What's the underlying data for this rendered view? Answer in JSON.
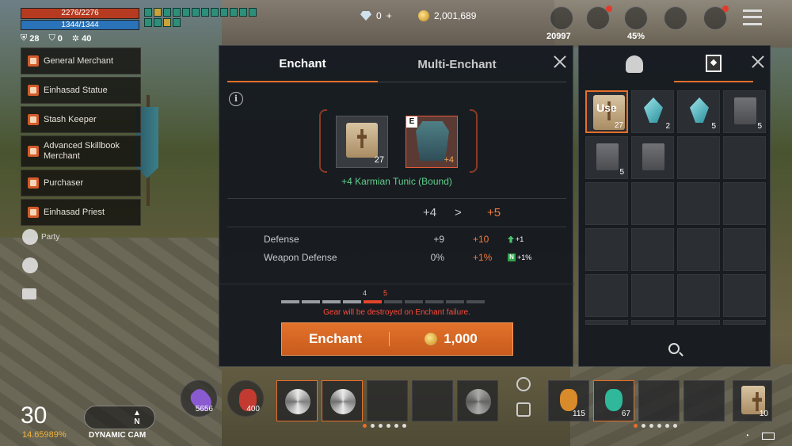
{
  "status": {
    "hp": "2276/2276",
    "mp": "1344/1344",
    "stat1": "28",
    "stat2": "0",
    "stat3": "40"
  },
  "npcs": [
    "General Merchant",
    "Einhasad Statue",
    "Stash Keeper",
    "Advanced Skillbook Merchant",
    "Purchaser",
    "Einhasad Priest"
  ],
  "side": {
    "party": "Party"
  },
  "currency": {
    "diamonds": "0",
    "adena": "2,001,689"
  },
  "top": {
    "feather": "20997",
    "weight": "45%"
  },
  "enchant": {
    "tab_enchant": "Enchant",
    "tab_multi": "Multi-Enchant",
    "scroll_count": "27",
    "gear_badge": "E",
    "gear_level": "+4",
    "item_name": "+4 Karmian Tunic (Bound)",
    "level_from": "+4",
    "level_arrow": ">",
    "level_to": "+5",
    "stats": [
      {
        "label": "Defense",
        "cur": "+9",
        "new": "+10",
        "diff": "+1"
      },
      {
        "label": "Weapon Defense",
        "cur": "0%",
        "new": "+1%",
        "diff": "+1%"
      }
    ],
    "progress": {
      "from": "4",
      "to": "5"
    },
    "warning": "Gear will be destroyed on Enchant failure.",
    "button_label": "Enchant",
    "cost": "1,000"
  },
  "inventory": {
    "use_label": "Use",
    "cells": [
      {
        "type": "scroll",
        "count": "27",
        "selected": true
      },
      {
        "type": "crystal",
        "count": "2"
      },
      {
        "type": "crystal",
        "count": "5"
      },
      {
        "type": "darkscroll",
        "count": "5"
      },
      {
        "type": "darkscroll",
        "count": "5"
      },
      {
        "type": "darkscroll",
        "count": ""
      }
    ]
  },
  "hud": {
    "level": "30",
    "exp": "14.65989%",
    "compass": "N",
    "camera": "DYNAMIC CAM",
    "quick": {
      "q1": "5656",
      "q2": "400",
      "q3": "115",
      "q4": "67",
      "q5": "10"
    }
  },
  "colors": {
    "accent": "#e56f2b",
    "green": "#5fd08a",
    "danger": "#ff4a3a"
  }
}
